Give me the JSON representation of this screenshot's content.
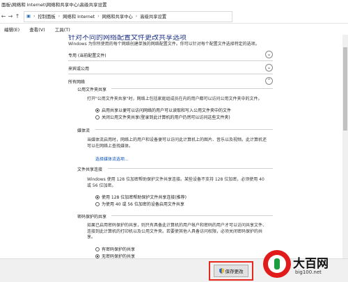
{
  "window": {
    "title": "面板\\网络和 Internet\\网络和共享中心\\高级共享设置"
  },
  "address": {
    "back_icon": "back-arrow-icon",
    "crumbs": [
      "控制面板",
      "网络和 Internet",
      "网络和共享中心",
      "高级共享设置"
    ],
    "separator": "›"
  },
  "menu": {
    "items": [
      "编辑(E)",
      "查看(V)",
      "工具(T)"
    ]
  },
  "page": {
    "heading": "针对不同的网络配置文件更改共享选项",
    "subtitle": "Windows 为你所使用的每个网络创建单独的网络配置文件。你可以针对每个配置文件选择特定的选项。",
    "profiles": [
      {
        "label": "专用 (当前配置文件)",
        "expanded": false
      },
      {
        "label": "来宾或公用",
        "expanded": false
      },
      {
        "label": "所有网络",
        "expanded": true
      }
    ],
    "public_folder": {
      "title": "公用文件夹共享",
      "desc": "打开\"公用文件夹共享\"时，网络上包括家庭组成员在内的用户都可以访问公用文件夹中的文件。",
      "options": [
        {
          "label": "启用共享以便可以访问网络的用户可以读取和写入公用文件夹中的文件",
          "selected": true
        },
        {
          "label": "关闭公用文件夹共享(登录到此计算机的用户仍然可以访问这些文件夹)",
          "selected": false
        }
      ]
    },
    "media": {
      "title": "媒体流",
      "desc": "当媒体流启用时，网络上的用户和设备便可以访问此计算机上的图片、音乐以及视频。此计算机还可以在网络上查找媒体。",
      "link": "选择媒体流选项..."
    },
    "file_sharing": {
      "title": "文件共享连接",
      "desc": "Windows 使用 128 位加密帮助保护文件共享连接。某些设备不支持 128 位加密，必须使用 40 或 56 位加密。",
      "options": [
        {
          "label": "使用 128 位加密帮助保护文件共享连接(推荐)",
          "selected": true
        },
        {
          "label": "为使用 40 或 56 位加密的设备启用文件共享",
          "selected": false
        }
      ]
    },
    "password": {
      "title": "密码保护的共享",
      "desc": "如果已启用密码保护的共享，则只有具备此计算机的用户帐户和密码的用户才可以访问共享文件、连接到此计算机的打印机以及公用文件夹。若要使其他人具备访问权限，必须关闭密码保护的共享。",
      "options": [
        {
          "label": "有密码保护的共享",
          "selected": false
        },
        {
          "label": "无密码保护的共享",
          "selected": true
        }
      ]
    }
  },
  "footer": {
    "save_label": "保存更改",
    "save_icon": "shield-icon",
    "highlight_color": "#e8261e"
  },
  "watermark": {
    "brand": "大百网",
    "url": "big100.net"
  }
}
